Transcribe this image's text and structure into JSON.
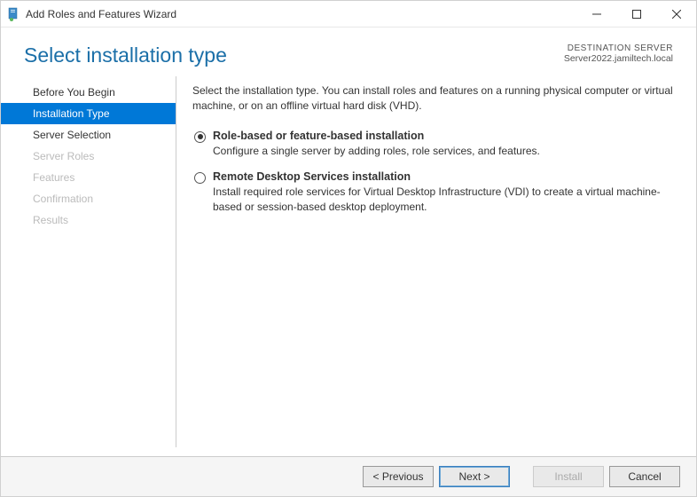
{
  "window": {
    "title": "Add Roles and Features Wizard"
  },
  "header": {
    "page_title": "Select installation type",
    "dest_label": "DESTINATION SERVER",
    "dest_server": "Server2022.jamiltech.local"
  },
  "sidebar": {
    "items": [
      {
        "label": "Before You Begin",
        "state": "enabled"
      },
      {
        "label": "Installation Type",
        "state": "active"
      },
      {
        "label": "Server Selection",
        "state": "enabled"
      },
      {
        "label": "Server Roles",
        "state": "disabled"
      },
      {
        "label": "Features",
        "state": "disabled"
      },
      {
        "label": "Confirmation",
        "state": "disabled"
      },
      {
        "label": "Results",
        "state": "disabled"
      }
    ]
  },
  "main": {
    "intro": "Select the installation type. You can install roles and features on a running physical computer or virtual machine, or on an offline virtual hard disk (VHD).",
    "options": [
      {
        "label": "Role-based or feature-based installation",
        "desc": "Configure a single server by adding roles, role services, and features.",
        "selected": true
      },
      {
        "label": "Remote Desktop Services installation",
        "desc": "Install required role services for Virtual Desktop Infrastructure (VDI) to create a virtual machine-based or session-based desktop deployment.",
        "selected": false
      }
    ]
  },
  "buttons": {
    "previous": "< Previous",
    "next": "Next >",
    "install": "Install",
    "cancel": "Cancel"
  }
}
